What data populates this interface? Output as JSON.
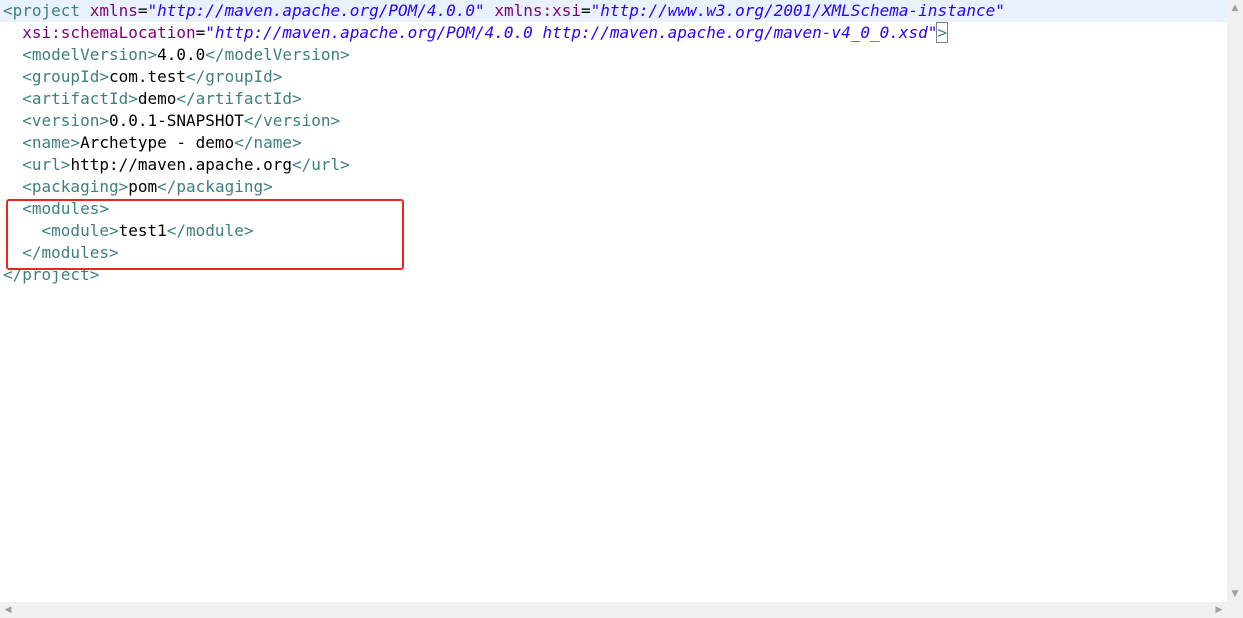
{
  "editor": {
    "lines": [
      {
        "segments": [
          {
            "cls": "tag",
            "text": "<project "
          },
          {
            "cls": "attr",
            "text": "xmlns"
          },
          {
            "cls": "txt",
            "text": "="
          },
          {
            "cls": "val",
            "text": "\"http://maven.apache.org/POM/4.0.0\""
          },
          {
            "cls": "txt",
            "text": " "
          },
          {
            "cls": "attr",
            "text": "xmlns:xsi"
          },
          {
            "cls": "txt",
            "text": "="
          },
          {
            "cls": "val",
            "text": "\"http://www.w3.org/2001/XMLSchema-instance\""
          }
        ]
      },
      {
        "segments": [
          {
            "cls": "txt",
            "text": "  "
          },
          {
            "cls": "attr",
            "text": "xsi:schemaLocation"
          },
          {
            "cls": "txt",
            "text": "="
          },
          {
            "cls": "val",
            "text": "\"http://maven.apache.org/POM/4.0.0 http://maven.apache.org/maven-v4_0_0.xsd\""
          },
          {
            "cls": "tag bracket-box",
            "text": ">"
          }
        ]
      },
      {
        "segments": [
          {
            "cls": "txt",
            "text": "  "
          },
          {
            "cls": "tag",
            "text": "<modelVersion>"
          },
          {
            "cls": "txt",
            "text": "4.0.0"
          },
          {
            "cls": "tag",
            "text": "</modelVersion>"
          }
        ]
      },
      {
        "segments": [
          {
            "cls": "txt",
            "text": "  "
          },
          {
            "cls": "tag",
            "text": "<groupId>"
          },
          {
            "cls": "txt",
            "text": "com.test"
          },
          {
            "cls": "tag",
            "text": "</groupId>"
          }
        ]
      },
      {
        "segments": [
          {
            "cls": "txt",
            "text": "  "
          },
          {
            "cls": "tag",
            "text": "<artifactId>"
          },
          {
            "cls": "txt",
            "text": "demo"
          },
          {
            "cls": "tag",
            "text": "</artifactId>"
          }
        ]
      },
      {
        "segments": [
          {
            "cls": "txt",
            "text": "  "
          },
          {
            "cls": "tag",
            "text": "<version>"
          },
          {
            "cls": "txt",
            "text": "0.0.1-SNAPSHOT"
          },
          {
            "cls": "tag",
            "text": "</version>"
          }
        ]
      },
      {
        "segments": [
          {
            "cls": "txt",
            "text": "  "
          },
          {
            "cls": "tag",
            "text": "<name>"
          },
          {
            "cls": "txt",
            "text": "Archetype - demo"
          },
          {
            "cls": "tag",
            "text": "</name>"
          }
        ]
      },
      {
        "segments": [
          {
            "cls": "txt",
            "text": "  "
          },
          {
            "cls": "tag",
            "text": "<url>"
          },
          {
            "cls": "txt",
            "text": "http://maven.apache.org"
          },
          {
            "cls": "tag",
            "text": "</url>"
          }
        ]
      },
      {
        "segments": [
          {
            "cls": "txt",
            "text": "  "
          },
          {
            "cls": "tag",
            "text": "<packaging>"
          },
          {
            "cls": "txt",
            "text": "pom"
          },
          {
            "cls": "tag",
            "text": "</packaging>"
          }
        ]
      },
      {
        "segments": [
          {
            "cls": "txt",
            "text": "  "
          },
          {
            "cls": "tag",
            "text": "<modules>"
          }
        ]
      },
      {
        "segments": [
          {
            "cls": "txt",
            "text": "    "
          },
          {
            "cls": "tag",
            "text": "<module>"
          },
          {
            "cls": "txt",
            "text": "test1"
          },
          {
            "cls": "tag",
            "text": "</module>"
          }
        ]
      },
      {
        "segments": [
          {
            "cls": "txt",
            "text": "  "
          },
          {
            "cls": "tag",
            "text": "</modules>"
          }
        ]
      },
      {
        "segments": [
          {
            "cls": "tag",
            "text": "</project>"
          }
        ]
      }
    ]
  },
  "annotation": {
    "color": "#e8271f"
  },
  "colors": {
    "tag": "#3f7f7f",
    "attribute": "#7f007f",
    "value": "#2a00ff",
    "text": "#000000",
    "current_line": "#e8f2fe"
  },
  "scrollbars": {
    "up_icon": "up-arrow-icon",
    "down_icon": "down-arrow-icon",
    "left_icon": "left-arrow-icon",
    "right_icon": "right-arrow-icon"
  }
}
